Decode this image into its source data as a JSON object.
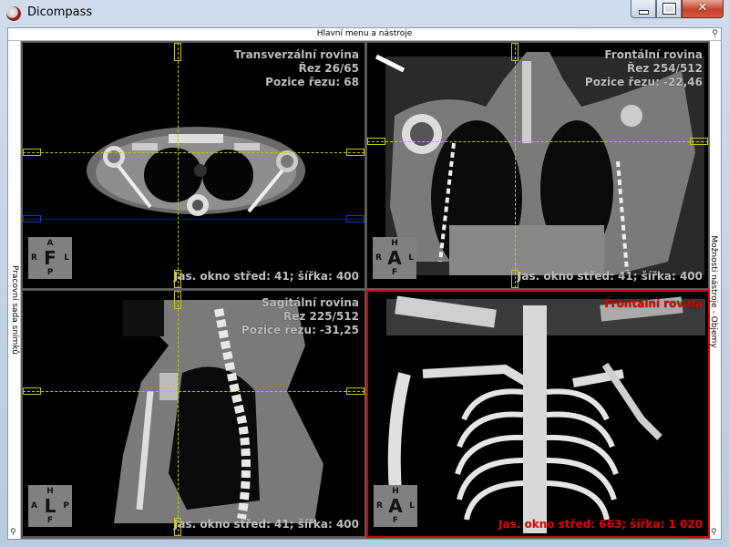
{
  "window": {
    "title": "Dicompass"
  },
  "toolbar": {
    "menu_label": "Hlavní menu a nástroje"
  },
  "sidebars": {
    "left_label": "Pracovní sada snímků",
    "right_label": "Možnosti nástroje - Objemy"
  },
  "panels": {
    "transversal": {
      "title": "Transverzální rovina",
      "slice": "Řez 26/65",
      "position": "Pozice řezu: 68",
      "window": "Jas. okno střed: 41; šířka: 400",
      "orient": {
        "top": "A",
        "center": "F",
        "bottom": "P",
        "left": "R",
        "right": "L"
      }
    },
    "frontal": {
      "title": "Frontální rovina",
      "slice": "Řez 254/512",
      "position": "Pozice řezu: -22,46",
      "window": "Jas. okno střed: 41; šířka: 400",
      "orient": {
        "top": "H",
        "center": "A",
        "bottom": "F",
        "left": "R",
        "right": "L"
      }
    },
    "sagittal": {
      "title": "Sagitální rovina",
      "slice": "Řez 225/512",
      "position": "Pozice řezu: -31,25",
      "window": "Jas. okno střed: 41; šířka: 400",
      "orient": {
        "top": "H",
        "center": "L",
        "bottom": "F",
        "left": "A",
        "right": "P"
      }
    },
    "volume": {
      "title": "Frontální rovina",
      "window": "Jas. okno střed: 663; šířka: 1 020",
      "orient": {
        "top": "H",
        "center": "A",
        "bottom": "F",
        "left": "R",
        "right": "L"
      }
    }
  },
  "colors": {
    "active_border": "#d40000",
    "crosshair": "#c6c600",
    "overlay_text": "#bdbdbd",
    "active_text": "#e60000"
  }
}
